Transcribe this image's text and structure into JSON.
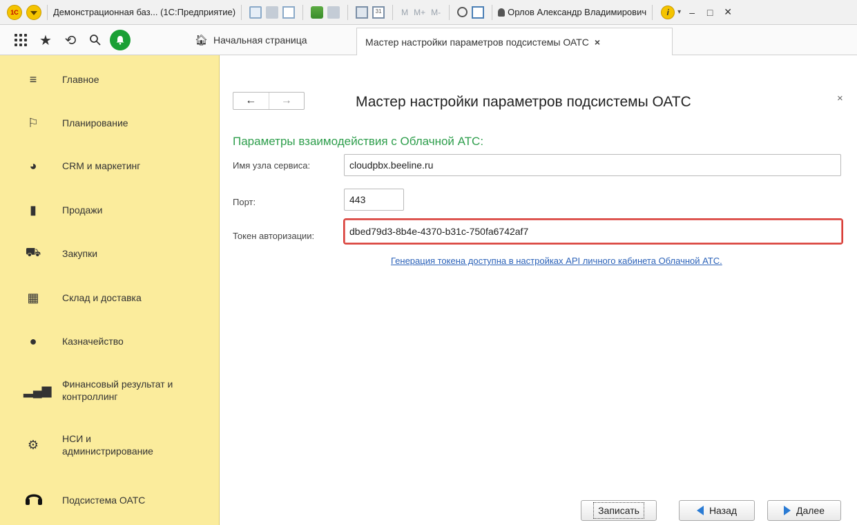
{
  "titlebar": {
    "app_title": "Демонстрационная баз... (1С:Предприятие)",
    "mem_labels": [
      "M",
      "M+",
      "M-"
    ],
    "user_name": "Орлов Александр Владимирович",
    "info_glyph": "i",
    "caret": "▾",
    "minimize": "–",
    "maximize": "□",
    "close": "✕"
  },
  "tabs": {
    "home_label": "Начальная страница",
    "active_label": "Мастер настройки параметров подсистемы ОАТС",
    "active_close": "×"
  },
  "sidebar": {
    "items": [
      {
        "label": "Главное",
        "icon": "menu-icon"
      },
      {
        "label": "Планирование",
        "icon": "planning-icon"
      },
      {
        "label": "CRM и маркетинг",
        "icon": "pie-chart-icon"
      },
      {
        "label": "Продажи",
        "icon": "shopping-bag-icon"
      },
      {
        "label": "Закупки",
        "icon": "cart-icon"
      },
      {
        "label": "Склад и доставка",
        "icon": "warehouse-icon"
      },
      {
        "label": "Казначейство",
        "icon": "ruble-icon"
      },
      {
        "label": "Финансовый результат и\nконтроллинг",
        "icon": "bar-chart-icon"
      },
      {
        "label": "НСИ и\nадминистрирование",
        "icon": "gear-icon"
      },
      {
        "label": "Подсистема ОАТС",
        "icon": "headset-icon"
      }
    ]
  },
  "form": {
    "title": "Мастер настройки параметров подсистемы ОАТС",
    "close": "×",
    "section_title": "Параметры взаимодействия с Облачной АТС:",
    "host_label": "Имя узла сервиса:",
    "host_value": "cloudpbx.beeline.ru",
    "port_label": "Порт:",
    "port_value": "443",
    "token_label": "Токен авторизации:",
    "token_value": "dbed79d3-8b4e-4370-b31c-750fa6742af7",
    "hint_link": "Генерация токена доступна в настройках API личного кабинета Облачной АТС."
  },
  "buttons": {
    "save": "Записать",
    "back": "Назад",
    "next": "Далее"
  },
  "colors": {
    "sidebar_bg": "#fbec9c",
    "section_title": "#2e9e4c",
    "highlight_border": "#d9403a",
    "link": "#2a61b8"
  }
}
